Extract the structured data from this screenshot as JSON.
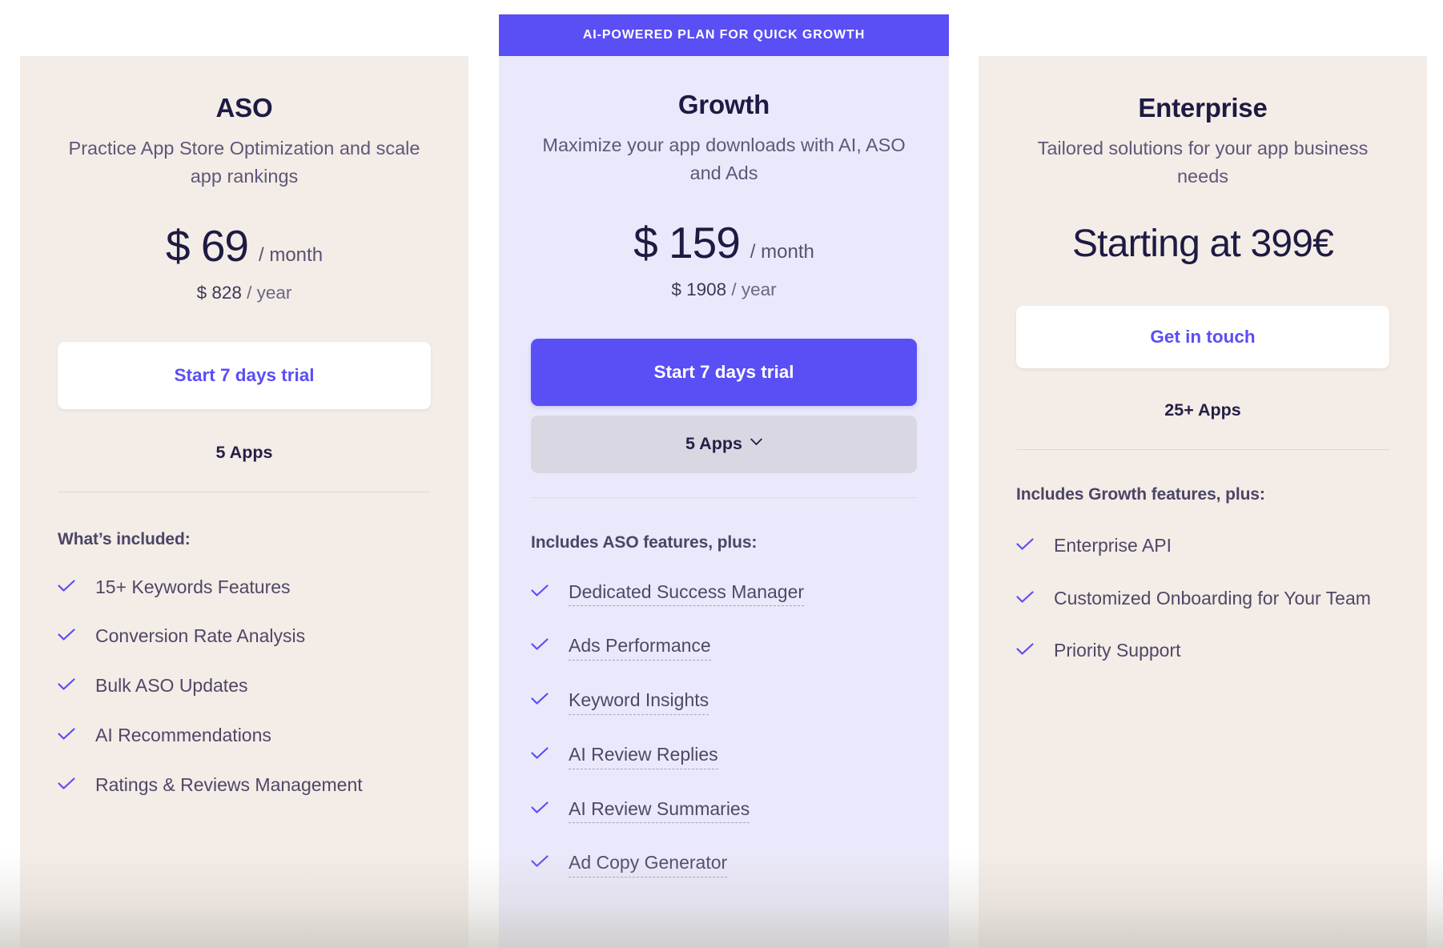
{
  "plans": [
    {
      "id": "aso",
      "name": "ASO",
      "description": "Practice App Store Optimization and scale app rankings",
      "price_amount": "$ 69",
      "price_period": "/ month",
      "price_year_amount": "$ 828",
      "price_year_period": "/ year",
      "cta_label": "Start 7 days trial",
      "apps_label": "5 Apps",
      "included_title": "What’s included:",
      "features": [
        "15+ Keywords Features",
        "Conversion Rate Analysis",
        "Bulk ASO Updates",
        "AI Recommendations",
        "Ratings & Reviews Management"
      ]
    },
    {
      "id": "growth",
      "ribbon_label": "AI-POWERED PLAN FOR QUICK GROWTH",
      "name": "Growth",
      "description": "Maximize your app downloads with AI, ASO and Ads",
      "price_amount": "$ 159",
      "price_period": "/ month",
      "price_year_amount": "$ 1908",
      "price_year_period": "/ year",
      "cta_label": "Start 7 days trial",
      "apps_label": "5 Apps",
      "apps_chevron_icon": "chevron-down-icon",
      "included_title": "Includes ASO features, plus:",
      "features": [
        "Dedicated Success Manager",
        "Ads Performance",
        "Keyword Insights",
        "AI Review Replies",
        "AI Review Summaries",
        "Ad Copy Generator"
      ]
    },
    {
      "id": "enterprise",
      "name": "Enterprise",
      "description": "Tailored solutions for your app business needs",
      "price_custom": "Starting at 399€",
      "cta_label": "Get in touch",
      "apps_label": "25+ Apps",
      "included_title": "Includes Growth features, plus:",
      "features": [
        "Enterprise API",
        "Customized Onboarding for Your Team",
        "Priority Support"
      ]
    }
  ],
  "icons": {
    "check": "check-icon",
    "chevron_down": "chevron-down-icon"
  },
  "colors": {
    "accent": "#5a4ef5",
    "card_warm_bg": "#f4ece7",
    "card_growth_bg": "#eae9fb",
    "heading": "#1d1b42",
    "body_text": "#4e4866",
    "select_bg": "#d8d7e2"
  }
}
